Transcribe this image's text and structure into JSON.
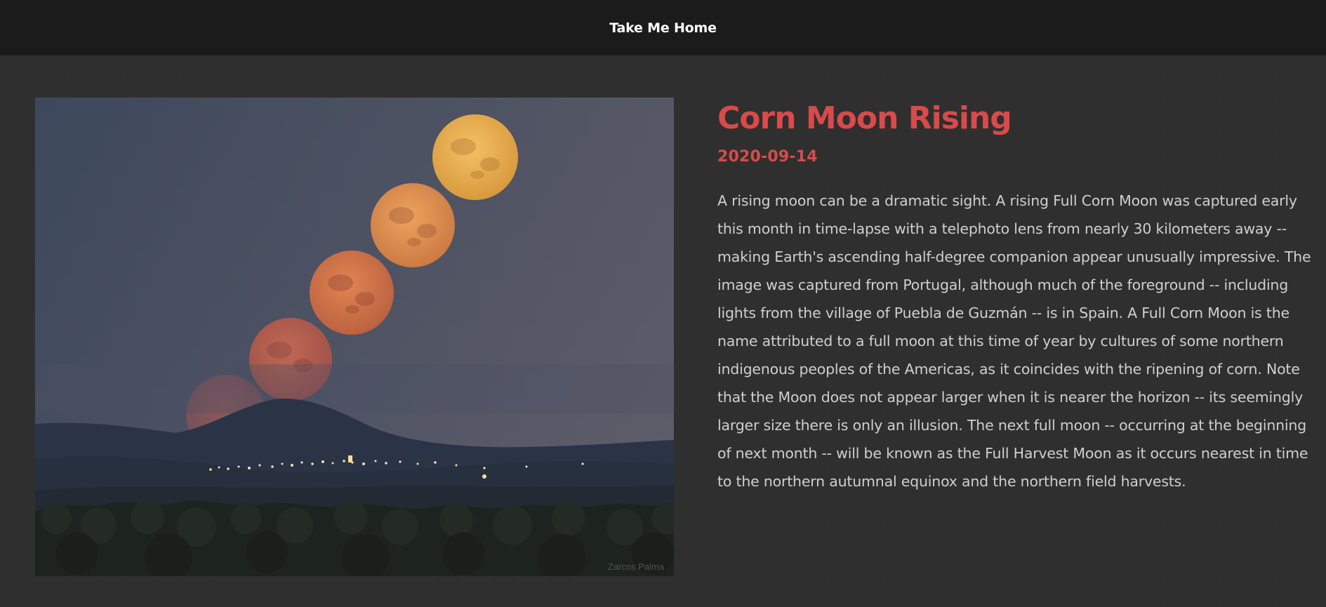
{
  "nav": {
    "home_label": "Take Me Home"
  },
  "apod": {
    "title": "Corn Moon Rising",
    "date": "2020-09-14",
    "image_alt": "Corn Moon Rising",
    "image_credit": "Zarcos Palma",
    "explanation": "A rising moon can be a dramatic sight. A rising Full Corn Moon was captured early this month in time-lapse with a telephoto lens from nearly 30 kilometers away -- making Earth's ascending half-degree companion appear unusually impressive. The image was captured from Portugal, although much of the foreground -- including lights from the village of Puebla de Guzmán -- is in Spain. A Full Corn Moon is the name attributed to a full moon at this time of year by cultures of some northern indigenous peoples of the Americas, as it coincides with the ripening of corn. Note that the Moon does not appear larger when it is nearer the horizon -- its seemingly larger size there is only an illusion. The next full moon -- occurring at the beginning of next month -- will be known as the Full Harvest Moon as it occurs nearest in time to the northern autumnal equinox and the northern field harvests."
  },
  "colors": {
    "accent": "#d94a4a",
    "background": "#232323",
    "topbar": "#1b1b1b",
    "body_text": "#cfcfcf"
  }
}
